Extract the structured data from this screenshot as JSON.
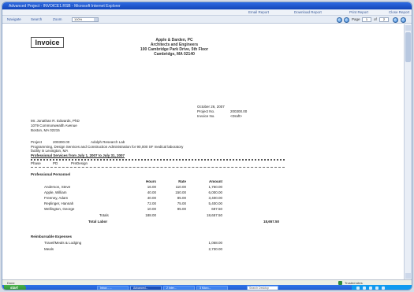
{
  "window": {
    "title": "Advanced Project - INVOICE1.RSB - Microsoft Internet Explorer"
  },
  "export_bar": {
    "links": [
      "Email Report",
      "Download Report",
      "Print Report",
      "Close Report"
    ]
  },
  "nav": {
    "navigate": "Navigate",
    "search": "Search",
    "zoom_label": "Zoom",
    "zoom_value": "100%",
    "page_label": "Page",
    "page_current": "1",
    "page_of": "of",
    "page_total": "2"
  },
  "invoice": {
    "title": "Invoice",
    "firm": {
      "name": "Apple & Darden, PC",
      "tagline": "Architects and Engineers",
      "address1": "100 Cambridge Park Drive, 5th Floor",
      "address2": "Cambridge, MA 02140"
    },
    "date": "October 26, 2007",
    "project_no_label": "Project No.",
    "project_no": "200300.00",
    "invoice_no_label": "Invoice No.",
    "invoice_no": "<Draft>",
    "client": {
      "name": "Mr. Jonathan R. Edwards, PhD",
      "address1": "1079 Commonwealth Avenue",
      "address2": "Boston, MA 02215"
    },
    "project_label": "Project",
    "project_id": "200300.00",
    "project_name": "Adolph Research Lab",
    "description": "Programming, Design Services and Construction Administration for 90,000 SF medical laboratory",
    "location": "facility in Lexington, MA",
    "services_heading": "Professional Services from July 1, 2007 to July 31, 2007",
    "phase_label": "Phase",
    "phase_code": "PD",
    "phase_name": "PreDesign",
    "section_heading": "Professional Personnel",
    "col_hours": "Hours",
    "col_rate": "Rate",
    "col_amount": "Amount",
    "personnel": [
      {
        "name": "Anderson, Steve",
        "hours": "16.00",
        "rate": "110.00",
        "amount": "1,760.00"
      },
      {
        "name": "Apple, William",
        "hours": "40.00",
        "rate": "150.00",
        "amount": "6,000.00"
      },
      {
        "name": "Freeney, Adam",
        "hours": "40.00",
        "rate": "85.00",
        "amount": "3,400.00"
      },
      {
        "name": "Replinger, Hannah",
        "hours": "72.00",
        "rate": "75.00",
        "amount": "5,400.00"
      },
      {
        "name": "Wellington, George",
        "hours": "10.00",
        "rate": "95.00",
        "amount": "697.50"
      }
    ],
    "totals_label": "Totals",
    "total_hours": "188.00",
    "total_amount": "18,657.50",
    "total_labor_label": "Total Labor",
    "total_labor": "18,657.50",
    "reimb_heading": "Reimbursable Expenses",
    "reimb_items": [
      {
        "name": "Travel/Meals & Lodging",
        "amount": "1,068.00"
      },
      {
        "name": "Meals",
        "amount": "2,730.00"
      }
    ]
  },
  "status": {
    "left": "Done",
    "zone": "Trusted sites"
  },
  "taskbar": {
    "start": "start",
    "buttons": [
      "Inbox - ...",
      "Advanced...",
      "2 Inter...",
      "3 Micro..."
    ],
    "search_placeholder": "Search Desktop"
  }
}
